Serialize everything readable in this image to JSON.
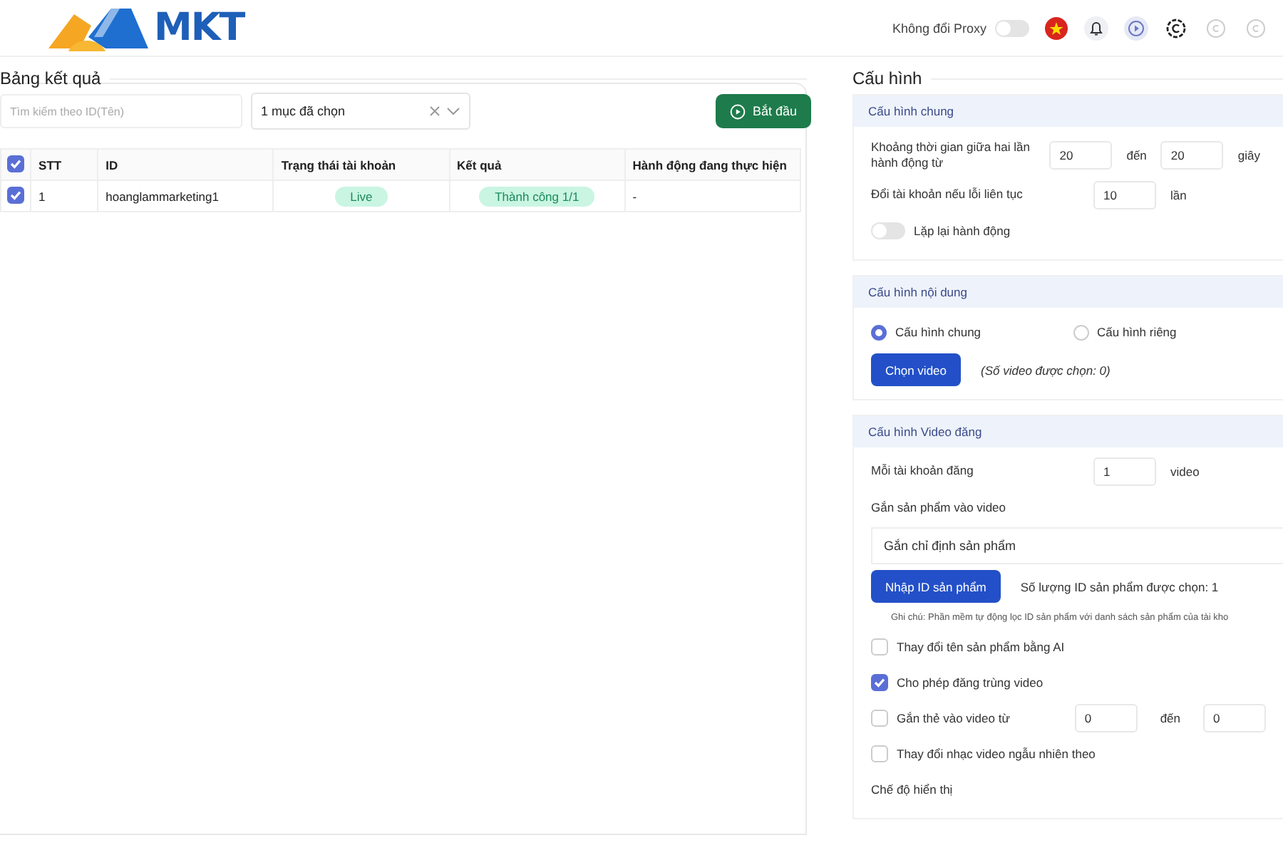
{
  "header": {
    "logo_text": "MKT",
    "proxy_label": "Không đổi Proxy",
    "proxy_on": false
  },
  "results": {
    "title": "Bảng kết quả",
    "search": {
      "placeholder": "Tìm kiếm theo ID(Tên)"
    },
    "select": {
      "value": "1 mục đã chọn"
    },
    "start_button": "Bắt đầu",
    "table": {
      "all_checked": true,
      "columns": [
        "STT",
        "ID",
        "Trạng thái tài khoản",
        "Kết quả",
        "Hành động đang thực hiện"
      ],
      "rows": [
        {
          "checked": true,
          "stt": "1",
          "id": "hoanglammarketing1",
          "status": "Live",
          "result": "Thành công 1/1",
          "action": "-"
        }
      ]
    }
  },
  "config": {
    "title": "Cấu hình",
    "sections": [
      {
        "title": "Cấu hình chung",
        "items": [
          {
            "kind": "range",
            "label": "Khoảng thời gian giữa hai lần hành động từ",
            "from": "20",
            "to_label": "đến",
            "to": "20",
            "unit": "giây"
          },
          {
            "kind": "number",
            "label": "Đổi tài khoản nếu lỗi liên tục",
            "value": "10",
            "unit": "lần"
          },
          {
            "kind": "toggle",
            "label": "Lặp lại hành động",
            "on": false
          }
        ]
      },
      {
        "title": "Cấu hình nội dung",
        "items": [
          {
            "kind": "radios",
            "options": [
              {
                "label": "Cấu hình chung",
                "selected": true
              },
              {
                "label": "Cấu hình riêng",
                "selected": false
              }
            ]
          },
          {
            "kind": "button_note",
            "button": "Chọn video",
            "note": "(Số video được chọn: 0)"
          }
        ]
      },
      {
        "title": "Cấu hình Video đăng",
        "items": [
          {
            "kind": "number",
            "label": "Mỗi tài khoản đăng",
            "value": "1",
            "unit": "video"
          },
          {
            "kind": "label",
            "label": "Gắn sản phẩm vào video"
          },
          {
            "kind": "select",
            "value": "Gắn chỉ định sản phẩm"
          },
          {
            "kind": "button_note",
            "button": "Nhập ID sản phẩm",
            "note": "Số lượng ID sản phẩm được chọn: 1"
          },
          {
            "kind": "hint",
            "label": "Ghi chú: Phần mềm tự động lọc ID sản phẩm với danh sách sản phẩm của tài kho"
          },
          {
            "kind": "checkbox",
            "label": "Thay đổi tên sản phẩm bằng AI",
            "checked": false
          },
          {
            "kind": "checkbox",
            "label": "Cho phép đăng trùng video",
            "checked": true
          },
          {
            "kind": "checkbox_range",
            "label": "Gắn thẻ vào video từ",
            "checked": false,
            "from": "0",
            "to_label": "đến",
            "to": "0"
          },
          {
            "kind": "checkbox",
            "label": "Thay đổi nhạc video ngẫu nhiên theo",
            "checked": false
          },
          {
            "kind": "label",
            "label": "Chế độ hiển thị"
          }
        ]
      }
    ]
  }
}
